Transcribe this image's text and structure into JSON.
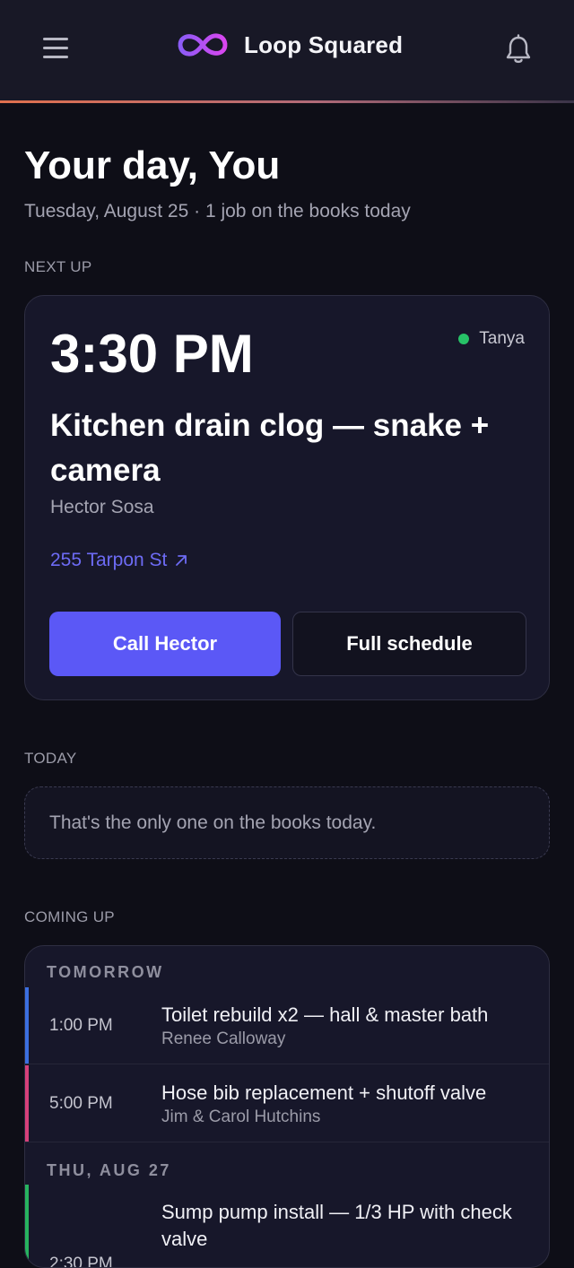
{
  "header": {
    "brand_name": "Loop Squared",
    "brand_color_start": "#8b5cf6",
    "brand_color_end": "#d946ef",
    "menu_icon": "hamburger-menu-icon",
    "notifications_icon": "bell-icon"
  },
  "greeting": {
    "title": "Your day, You",
    "subtitle": "Tuesday, August 25 · 1 job on the books today"
  },
  "next_up": {
    "section_label": "NEXT UP",
    "time": "3:30 PM",
    "technician": "Tanya",
    "technician_status_color": "#27c267",
    "job_title": "Kitchen drain clog — snake + camera",
    "client": "Hector Sosa",
    "address": "255 Tarpon St",
    "primary_action": "Call Hector",
    "secondary_action": "Full schedule",
    "accent_color": "#5b58f6"
  },
  "today": {
    "section_label": "TODAY",
    "empty_message": "That's the only one on the books today."
  },
  "coming_up": {
    "section_label": "COMING UP",
    "groups": [
      {
        "label": "TOMORROW",
        "jobs": [
          {
            "time": "1:00 PM",
            "title": "Toilet rebuild x2 — hall & master bath",
            "client": "Renee Calloway",
            "color": "#3b6fe0"
          },
          {
            "time": "5:00 PM",
            "title": "Hose bib replacement + shutoff valve",
            "client": "Jim & Carol Hutchins",
            "color": "#d6407a"
          }
        ]
      },
      {
        "label": "THU, AUG 27",
        "jobs": [
          {
            "time": "2:30 PM",
            "title": "Sump pump install — 1/3 HP with check valve",
            "client": "",
            "color": "#27b35f"
          }
        ]
      }
    ]
  }
}
